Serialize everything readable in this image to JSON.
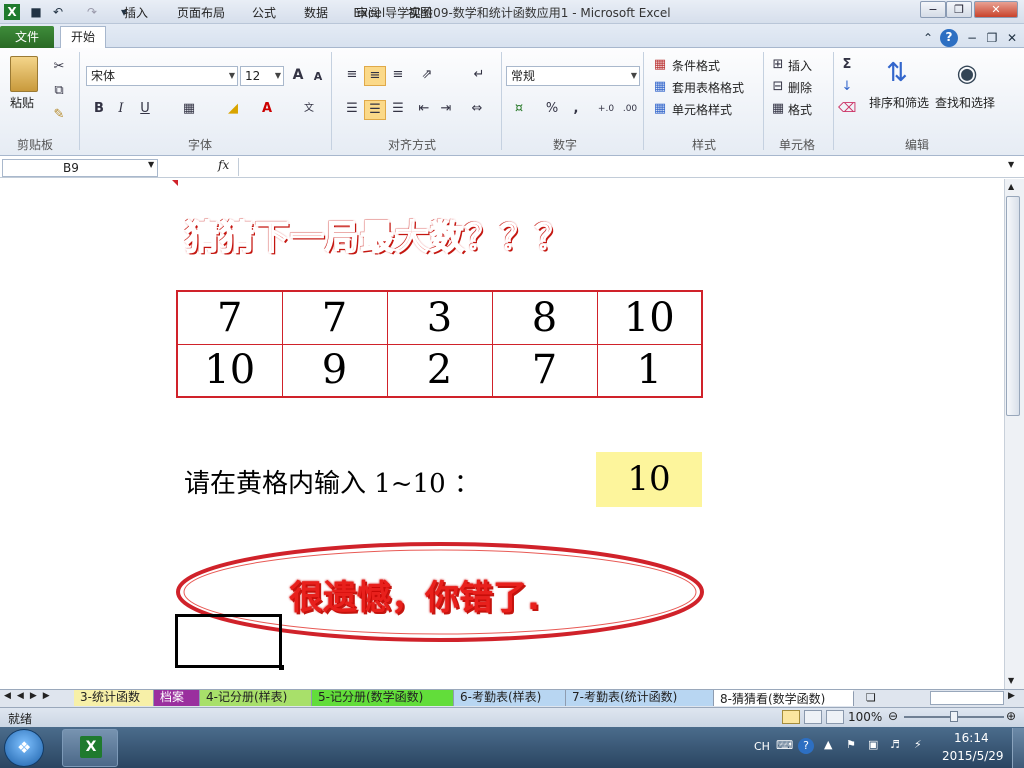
{
  "window": {
    "title": "Excel导学实验09-数学和统计函数应用1  -  Microsoft Excel",
    "minimize": "−",
    "restore": "❐",
    "close": "✕"
  },
  "ribbon": {
    "tabs": [
      "文件",
      "开始",
      "插入",
      "页面布局",
      "公式",
      "数据",
      "审阅",
      "视图"
    ],
    "clipboard": {
      "paste": "粘贴",
      "label": "剪贴板"
    },
    "font": {
      "name": "宋体",
      "size": "12",
      "label": "字体",
      "bold": "B",
      "italic": "I",
      "underline": "U",
      "grow": "A",
      "shrink": "A"
    },
    "alignment": {
      "label": "对齐方式"
    },
    "number": {
      "format": "常规",
      "label": "数字",
      "percent": "%",
      "comma": ","
    },
    "styles": {
      "conditional": "条件格式",
      "table": "套用表格格式",
      "cell": "单元格样式",
      "label": "样式"
    },
    "cells": {
      "insert": "插入",
      "delete": "删除",
      "format": "格式",
      "label": "单元格"
    },
    "editing": {
      "sum": "Σ",
      "sort": "排序和筛选",
      "find": "查找和选择",
      "label": "编辑"
    }
  },
  "formula_bar": {
    "name_box": "B9",
    "fx": "fx",
    "value": ""
  },
  "sheet": {
    "title": "猜猜下一局最大数？？？",
    "grid": [
      [
        "7",
        "7",
        "3",
        "8",
        "10"
      ],
      [
        "10",
        "9",
        "2",
        "7",
        "1"
      ]
    ],
    "prompt": "请在黄格内输入 1~10 ：",
    "input_value": "10",
    "result": "很遗憾，你错了."
  },
  "sheet_tabs": [
    "3-统计函数",
    "档案",
    "4-记分册(样表)",
    "5-记分册(数学函数)",
    "6-考勤表(样表)",
    "7-考勤表(统计函数)",
    "8-猜猜看(数学函数)"
  ],
  "sheet_tab_colors": [
    "#f7f0a8",
    "#9a2f9e",
    "#a8e06a",
    "#62dd3a",
    "#b8d6f2",
    "#b8d6f2",
    "#ffffff"
  ],
  "status": {
    "ready": "就绪",
    "zoom": "100%"
  },
  "taskbar": {
    "lang": "CH",
    "time": "16:14",
    "date": "2015/5/29"
  }
}
